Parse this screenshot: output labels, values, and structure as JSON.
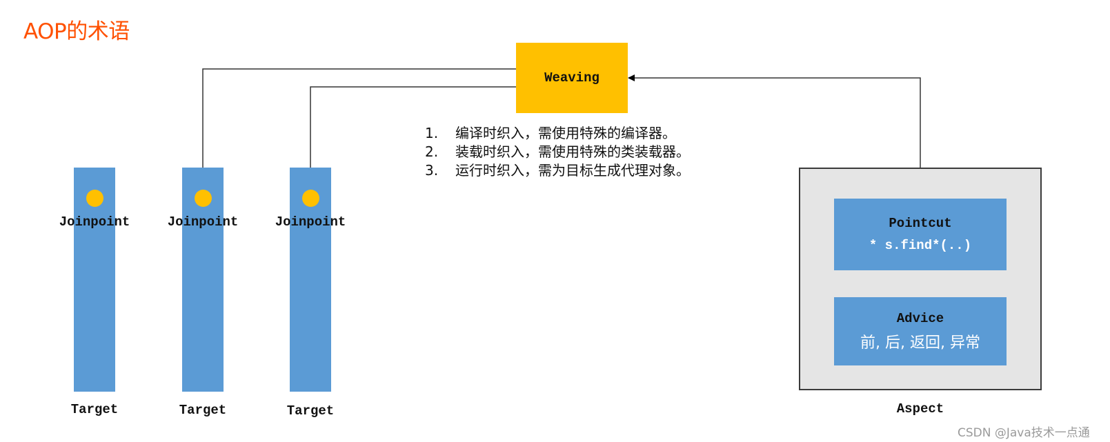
{
  "title": "AOP的术语",
  "weaving": {
    "label": "Weaving",
    "color": "#FFC000"
  },
  "weaving_steps": [
    {
      "num": "1.",
      "text": "编译时织入，需使用特殊的编译器。"
    },
    {
      "num": "2.",
      "text": "装载时织入，需使用特殊的类装载器。"
    },
    {
      "num": "3.",
      "text": "运行时织入，需为目标生成代理对象。"
    }
  ],
  "targets": [
    {
      "joinpoint_label": "Joinpoint",
      "target_label": "Target"
    },
    {
      "joinpoint_label": "Joinpoint",
      "target_label": "Target"
    },
    {
      "joinpoint_label": "Joinpoint",
      "target_label": "Target"
    }
  ],
  "aspect": {
    "label": "Aspect",
    "pointcut": {
      "title": "Pointcut",
      "expression": "* s.find*(..)"
    },
    "advice": {
      "title": "Advice",
      "types": "前, 后, 返回, 异常"
    }
  },
  "watermark": "CSDN @Java技术一点通",
  "colors": {
    "title": "#FF5000",
    "target_bar": "#5B9BD5",
    "joinpoint_dot": "#FFC000",
    "aspect_bg": "#E5E5E5"
  }
}
